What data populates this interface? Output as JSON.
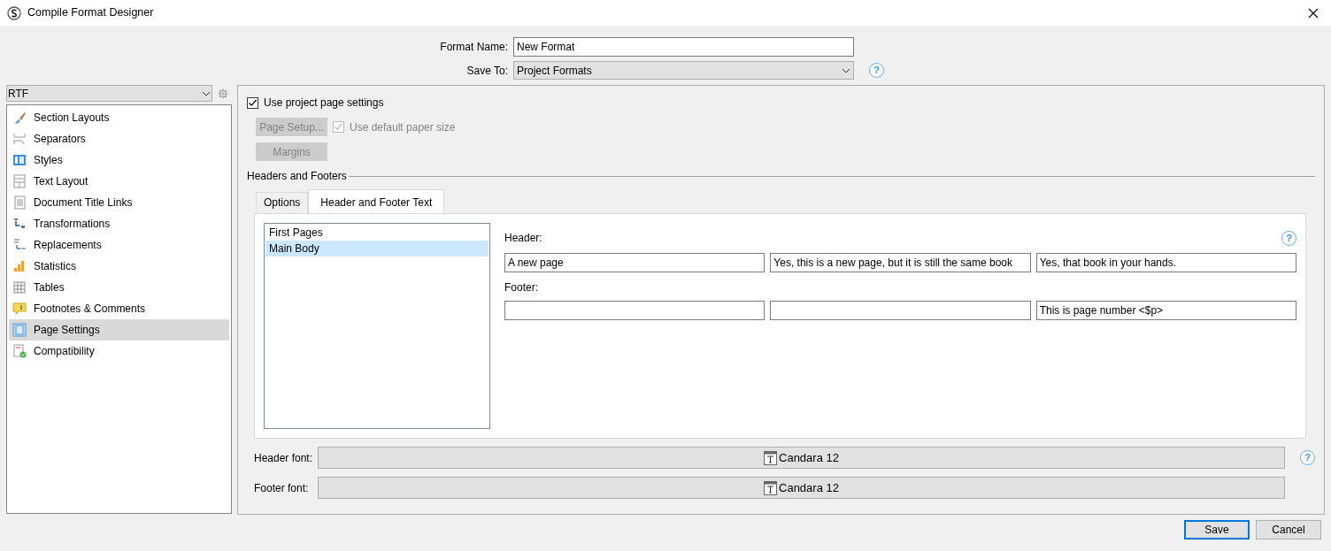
{
  "window": {
    "title": "Compile Format Designer"
  },
  "format_name": {
    "label": "Format Name:",
    "value": "New Format"
  },
  "save_to": {
    "label": "Save To:",
    "value": "Project Formats",
    "help": "?"
  },
  "compile_for": {
    "value": "RTF"
  },
  "sidebar": {
    "items": [
      {
        "label": "Section Layouts",
        "selected": false
      },
      {
        "label": "Separators",
        "selected": false
      },
      {
        "label": "Styles",
        "selected": false
      },
      {
        "label": "Text Layout",
        "selected": false
      },
      {
        "label": "Document Title Links",
        "selected": false
      },
      {
        "label": "Transformations",
        "selected": false
      },
      {
        "label": "Replacements",
        "selected": false
      },
      {
        "label": "Statistics",
        "selected": false
      },
      {
        "label": "Tables",
        "selected": false
      },
      {
        "label": "Footnotes & Comments",
        "selected": false
      },
      {
        "label": "Page Settings",
        "selected": true
      },
      {
        "label": "Compatibility",
        "selected": false
      }
    ]
  },
  "page_settings": {
    "use_project": {
      "label": "Use project page settings",
      "checked": true
    },
    "page_setup_button": {
      "label": "Page Setup...",
      "disabled": true
    },
    "default_paper": {
      "label": "Use default paper size",
      "checked": true,
      "disabled": true
    },
    "margins_button": {
      "label": "Margins",
      "disabled": true
    },
    "group_title": "Headers and Footers",
    "tabs": [
      {
        "label": "Options",
        "selected": false
      },
      {
        "label": "Header and Footer Text",
        "selected": true
      }
    ],
    "sections": [
      {
        "label": "First Pages",
        "selected": false
      },
      {
        "label": "Main Body",
        "selected": true
      }
    ],
    "header": {
      "label": "Header:",
      "help": "?",
      "fields": [
        {
          "value": "A new page"
        },
        {
          "value": "Yes, this is a new page, but it is still the same book"
        },
        {
          "value": "Yes, that book in your hands."
        }
      ]
    },
    "footer": {
      "label": "Footer:",
      "fields": [
        {
          "kind": "empty"
        },
        {
          "kind": "empty"
        },
        {
          "kind": "text",
          "value": "This is page number <$p>"
        }
      ]
    },
    "header_font": {
      "label": "Header font:",
      "value": "Candara 12",
      "help": "?"
    },
    "footer_font": {
      "label": "Footer font:",
      "value": "Candara 12"
    }
  },
  "buttons": [
    {
      "label": "Save",
      "kind": "default"
    },
    {
      "label": "Cancel",
      "kind": "normal"
    }
  ]
}
